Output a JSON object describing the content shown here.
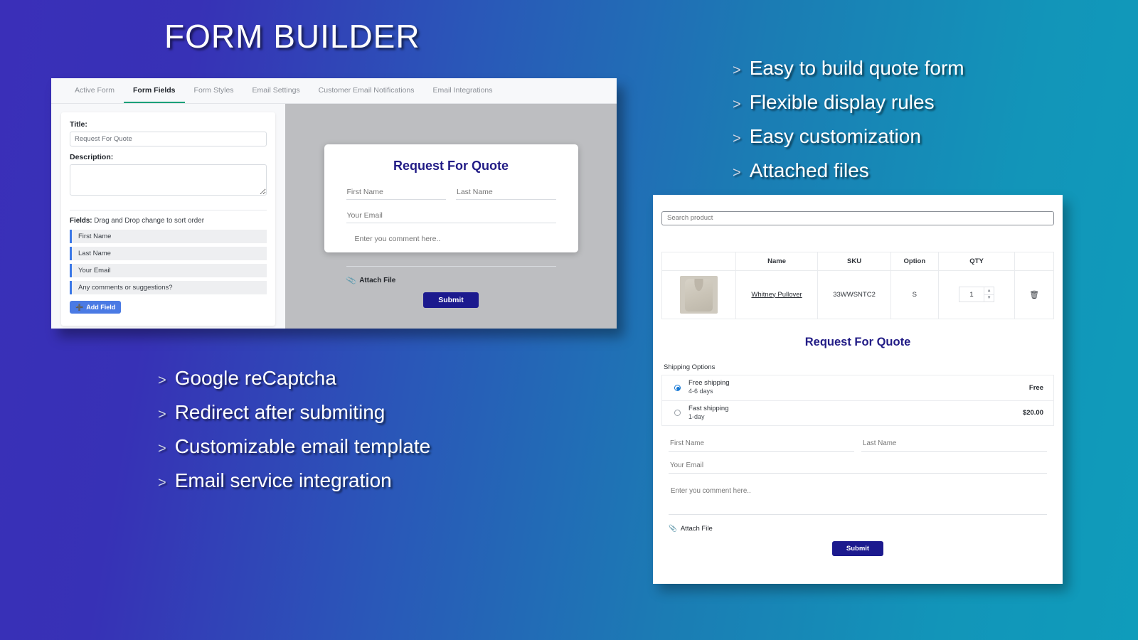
{
  "theme": {
    "gradient_left": "#3a2fb8",
    "gradient_right": "#0f9cbb",
    "accent_navy": "#1c1a8e",
    "accent_blue": "#4a7ae4",
    "accent_green": "#1aa179",
    "radio_blue": "#1477d4"
  },
  "hero": {
    "title": "FORM BUILDER"
  },
  "features_top": [
    {
      "chevron": ">",
      "label": "Easy to build quote form"
    },
    {
      "chevron": ">",
      "label": "Flexible display rules"
    },
    {
      "chevron": ">",
      "label": "Easy customization"
    },
    {
      "chevron": ">",
      "label": "Attached files"
    }
  ],
  "features_bottom": [
    {
      "chevron": ">",
      "label": "Google reCaptcha"
    },
    {
      "chevron": ">",
      "label": "Redirect after submiting"
    },
    {
      "chevron": ">",
      "label": "Customizable email template"
    },
    {
      "chevron": ">",
      "label": "Email service integration"
    }
  ],
  "builder": {
    "tabs": [
      {
        "label": "Active Form",
        "active": false
      },
      {
        "label": "Form Fields",
        "active": true
      },
      {
        "label": "Form Styles",
        "active": false
      },
      {
        "label": "Email Settings",
        "active": false
      },
      {
        "label": "Customer Email Notifications",
        "active": false
      },
      {
        "label": "Email Integrations",
        "active": false
      }
    ],
    "title_label": "Title:",
    "title_value": "Request For Quote",
    "description_label": "Description:",
    "description_value": "",
    "fields_hint_bold": "Fields:",
    "fields_hint_rest": " Drag and Drop change to sort order",
    "fields": [
      {
        "label": "First Name"
      },
      {
        "label": "Last Name"
      },
      {
        "label": "Your Email"
      },
      {
        "label": "Any comments or suggestions?"
      }
    ],
    "add_field_label": "Add Field",
    "add_field_icon": "plus-icon"
  },
  "preview_form": {
    "title": "Request For Quote",
    "first_name_placeholder": "First Name",
    "last_name_placeholder": "Last Name",
    "email_placeholder": "Your Email",
    "comment_placeholder": "Enter you comment here..",
    "attach_label": "Attach File",
    "attach_icon": "paperclip-icon",
    "submit_label": "Submit"
  },
  "storefront": {
    "search_placeholder": "Search product",
    "table": {
      "headers": [
        "",
        "Name",
        "SKU",
        "Option",
        "QTY",
        ""
      ],
      "rows": [
        {
          "image": "product-thumbnail",
          "name": "Whitney Pullover",
          "sku": "33WWSNTC2",
          "option": "S",
          "qty": "1",
          "delete_icon": "trash-icon"
        }
      ]
    },
    "quote_title": "Request For Quote",
    "shipping_label": "Shipping Options",
    "shipping_options": [
      {
        "name": "Free shipping",
        "detail": "4-6 days",
        "price": "Free",
        "selected": true
      },
      {
        "name": "Fast shipping",
        "detail": "1-day",
        "price": "$20.00",
        "selected": false
      }
    ],
    "first_name_placeholder": "First Name",
    "last_name_placeholder": "Last Name",
    "email_placeholder": "Your Email",
    "comment_placeholder": "Enter you comment here..",
    "attach_label": "Attach File",
    "attach_icon": "paperclip-icon",
    "submit_label": "Submit"
  }
}
